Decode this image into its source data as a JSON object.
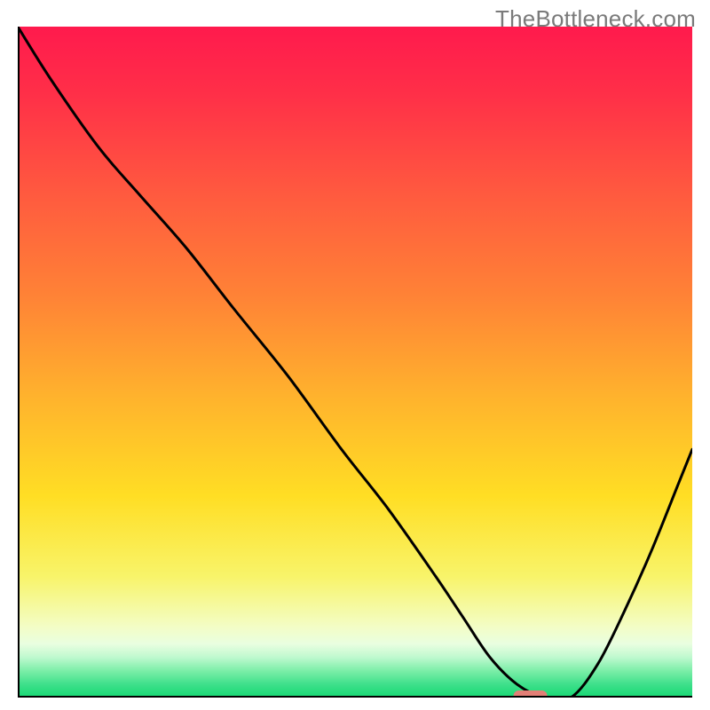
{
  "watermark": "TheBottleneck.com",
  "chart_data": {
    "type": "line",
    "title": "",
    "xlabel": "",
    "ylabel": "",
    "xlim": [
      0,
      100
    ],
    "ylim": [
      0,
      100
    ],
    "gradient_stops": [
      {
        "pos": 0,
        "color": "#ff1a4d"
      },
      {
        "pos": 10,
        "color": "#ff2f48"
      },
      {
        "pos": 25,
        "color": "#ff5a3f"
      },
      {
        "pos": 40,
        "color": "#ff8236"
      },
      {
        "pos": 55,
        "color": "#ffb22d"
      },
      {
        "pos": 70,
        "color": "#ffde24"
      },
      {
        "pos": 82,
        "color": "#f8f46a"
      },
      {
        "pos": 89.5,
        "color": "#f3fdc6"
      },
      {
        "pos": 92,
        "color": "#e9fee0"
      },
      {
        "pos": 94,
        "color": "#bff9cf"
      },
      {
        "pos": 96,
        "color": "#7ceea8"
      },
      {
        "pos": 98,
        "color": "#3fe08b"
      },
      {
        "pos": 100,
        "color": "#15d873"
      }
    ],
    "series": [
      {
        "name": "curve",
        "x": [
          0,
          5,
          12,
          18,
          25,
          32,
          40,
          48,
          55,
          62,
          66,
          70,
          74,
          78,
          82,
          86,
          90,
          94,
          98,
          100
        ],
        "values": [
          100,
          92,
          82,
          75,
          67,
          58,
          48,
          37,
          28,
          18,
          12,
          6,
          2,
          0,
          0,
          5,
          13,
          22,
          32,
          37
        ]
      }
    ],
    "marker": {
      "x_start": 73.5,
      "x_end": 78.5,
      "y": 0,
      "height": 1
    }
  }
}
